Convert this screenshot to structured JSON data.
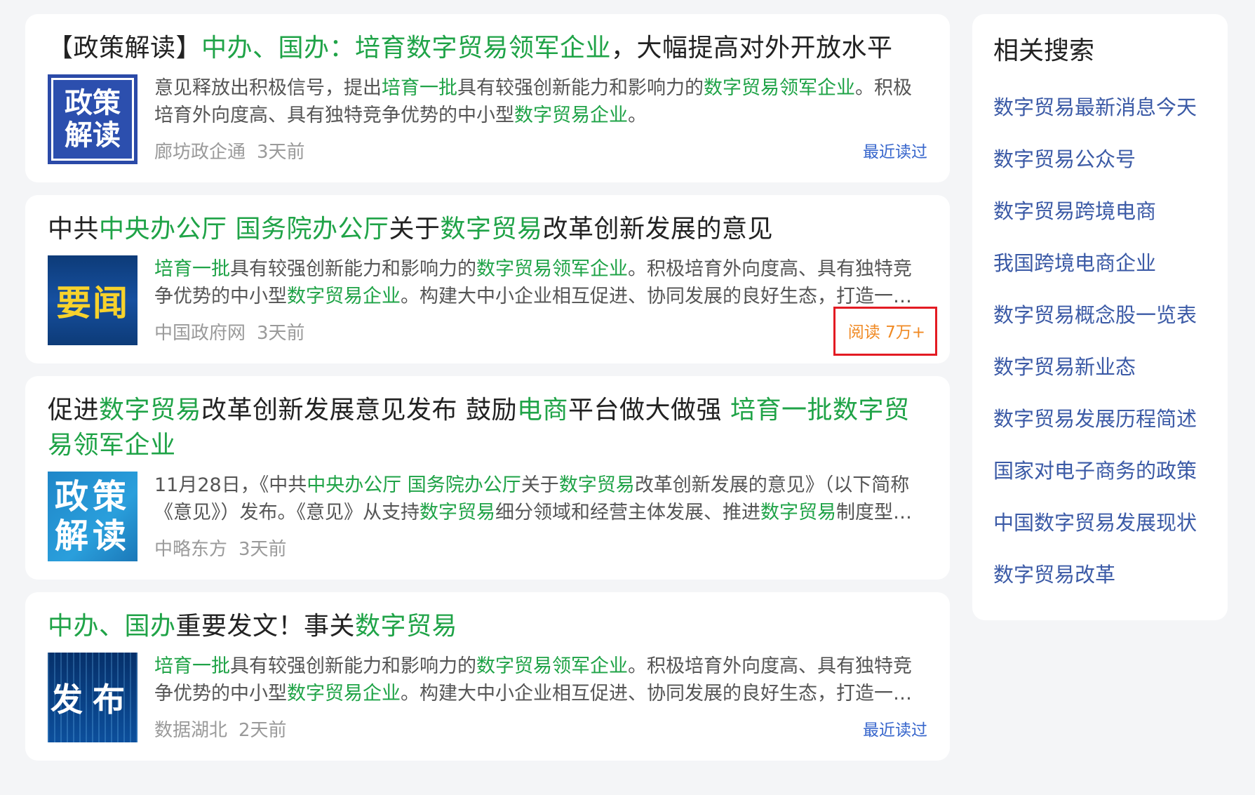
{
  "results": [
    {
      "title": [
        {
          "t": "【政策解读】",
          "hl": false
        },
        {
          "t": "中办、国办：培育数字贸易领军企业",
          "hl": true
        },
        {
          "t": "，大幅提高对外开放水平",
          "hl": false
        }
      ],
      "thumb": {
        "style": "t1",
        "text": "政策解读"
      },
      "summary": [
        {
          "t": "意见释放出积极信号，提出",
          "hl": false
        },
        {
          "t": "培育一批",
          "hl": true
        },
        {
          "t": "具有较强创新能力和影响力的",
          "hl": false
        },
        {
          "t": "数字贸易领军企业",
          "hl": true
        },
        {
          "t": "。积极培育外向度高、具有独特竞争优势的中小型",
          "hl": false
        },
        {
          "t": "数字贸易企业",
          "hl": true
        },
        {
          "t": "。",
          "hl": false
        }
      ],
      "source": "廊坊政企通",
      "time": "3天前",
      "right_label": "最近读过",
      "right_type": "link"
    },
    {
      "title": [
        {
          "t": "中共",
          "hl": false
        },
        {
          "t": "中央办公厅 国务院办公厅",
          "hl": true
        },
        {
          "t": "关于",
          "hl": false
        },
        {
          "t": "数字贸易",
          "hl": true
        },
        {
          "t": "改革创新发展的意见",
          "hl": false
        }
      ],
      "thumb": {
        "style": "t2",
        "text": "要闻"
      },
      "summary": [
        {
          "t": "培育一批",
          "hl": true
        },
        {
          "t": "具有较强创新能力和影响力的",
          "hl": false
        },
        {
          "t": "数字贸易领军企业",
          "hl": true
        },
        {
          "t": "。积极培育外向度高、具有独特竞争优势的中小型",
          "hl": false
        },
        {
          "t": "数字贸易企业",
          "hl": true
        },
        {
          "t": "。构建大中小企业相互促进、协同发展的良好生态，打造一批具有国际竞争力的企业。",
          "hl": false
        }
      ],
      "source": "中国政府网",
      "time": "3天前",
      "right_label": "阅读 7万+",
      "right_type": "count"
    },
    {
      "title": [
        {
          "t": "促进",
          "hl": false
        },
        {
          "t": "数字贸易",
          "hl": true
        },
        {
          "t": "改革创新发展意见发布 鼓励",
          "hl": false
        },
        {
          "t": "电商",
          "hl": true
        },
        {
          "t": "平台做大做强 ",
          "hl": false
        },
        {
          "t": "培育一批数字贸易领军企业",
          "hl": true
        }
      ],
      "thumb": {
        "style": "t3",
        "text": "政策解读"
      },
      "summary": [
        {
          "t": "11月28日，《中共",
          "hl": false
        },
        {
          "t": "中央办公厅 国务院办公厅",
          "hl": true
        },
        {
          "t": "关于",
          "hl": false
        },
        {
          "t": "数字贸易",
          "hl": true
        },
        {
          "t": "改革创新发展的意见》（以下简称《意见》）发布。《意见》从支持",
          "hl": false
        },
        {
          "t": "数字贸易",
          "hl": true
        },
        {
          "t": "细分领域和经营主体发展、推进",
          "hl": false
        },
        {
          "t": "数字贸易",
          "hl": true
        },
        {
          "t": "制度型开放等方面提出了具体举措。",
          "hl": false
        }
      ],
      "source": "中略东方",
      "time": "3天前",
      "right_label": "",
      "right_type": "none"
    },
    {
      "title": [
        {
          "t": "中办、国办",
          "hl": true
        },
        {
          "t": "重要发文！事关",
          "hl": false
        },
        {
          "t": "数字贸易",
          "hl": true
        }
      ],
      "thumb": {
        "style": "t4",
        "text": "发布"
      },
      "summary": [
        {
          "t": "培育一批",
          "hl": true
        },
        {
          "t": "具有较强创新能力和影响力的",
          "hl": false
        },
        {
          "t": "数字贸易领军企业",
          "hl": true
        },
        {
          "t": "。积极培育外向度高、具有独特竞争优势的中小型",
          "hl": false
        },
        {
          "t": "数字贸易企业",
          "hl": true
        },
        {
          "t": "。构建大中小企业相互促进、协同发展的良好生态，打造一批具有国际竞争力的企业。",
          "hl": false
        }
      ],
      "source": "数据湖北",
      "time": "2天前",
      "right_label": "最近读过",
      "right_type": "link"
    }
  ],
  "sidebar": {
    "title": "相关搜索",
    "items": [
      "数字贸易最新消息今天",
      "数字贸易公众号",
      "数字贸易跨境电商",
      "我国跨境电商企业",
      "数字贸易概念股一览表",
      "数字贸易新业态",
      "数字贸易发展历程简述",
      "国家对电子商务的政策",
      "中国数字贸易发展现状",
      "数字贸易改革"
    ]
  },
  "colors": {
    "highlight": "#1fa347",
    "link": "#3766cc",
    "read_count": "#f08a24",
    "annotation_box": "#e31b23"
  }
}
